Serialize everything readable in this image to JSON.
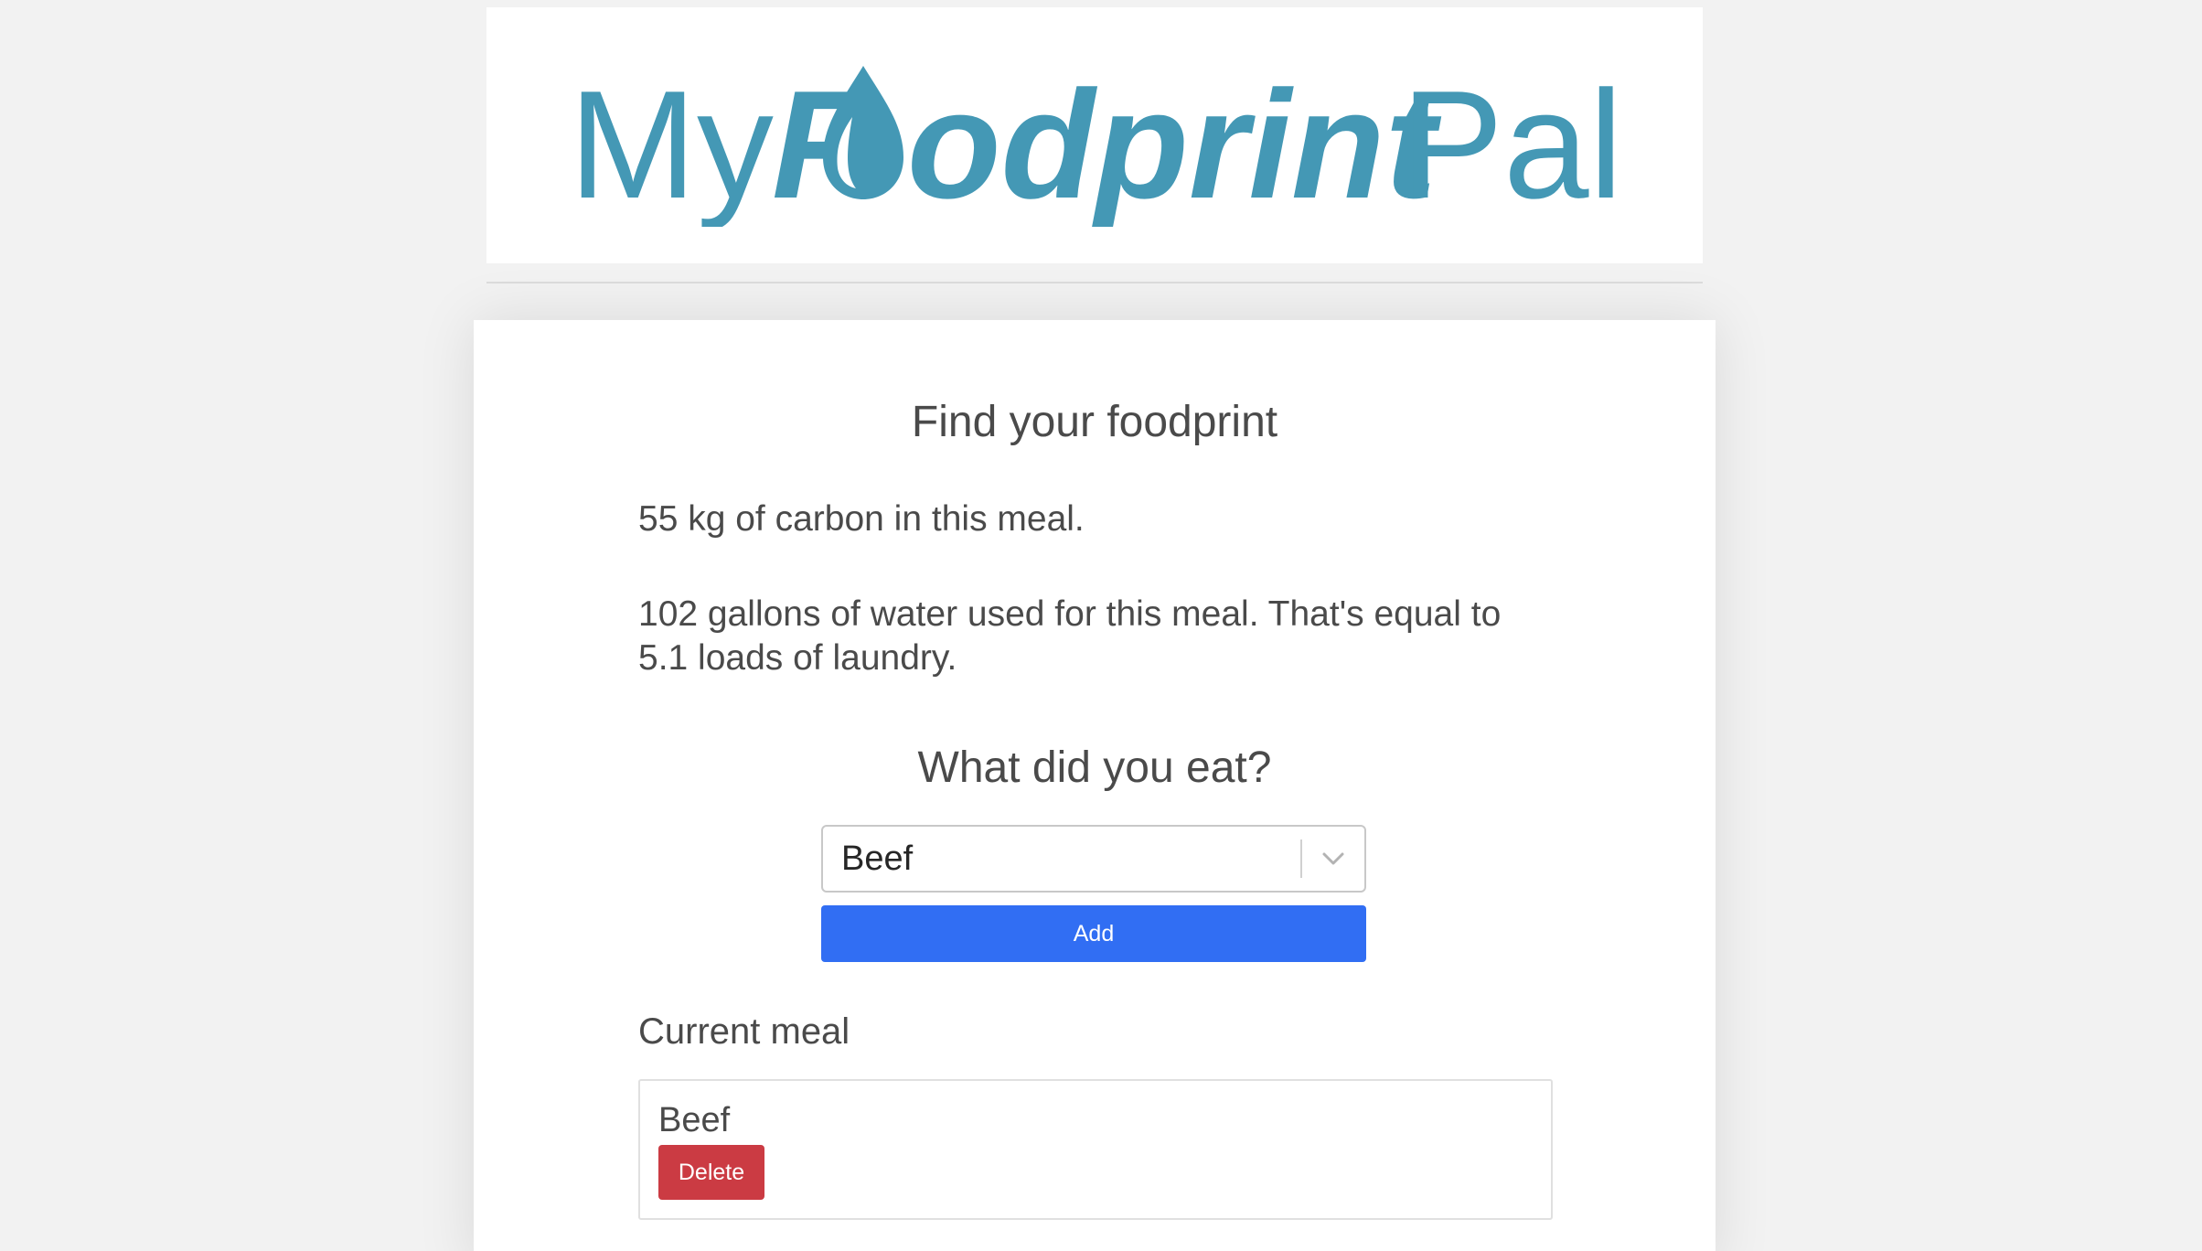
{
  "header": {
    "logo": {
      "part1": "My",
      "part2_f": "F",
      "part2_rest": "odprint",
      "part3": "Pal",
      "color": "#4498b5"
    }
  },
  "card": {
    "title": "Find your foodprint",
    "carbon_text": "55 kg of carbon in this meal.",
    "water_line1": "102 gallons of water used for this meal. That's equal to",
    "water_line2": "5.1 loads of laundry.",
    "eat_title": "What did you eat?",
    "food_select": {
      "value": "Beef",
      "icon": "chevron-down-icon"
    },
    "add_label": "Add",
    "current_meal_title": "Current meal",
    "meal_items": [
      {
        "name": "Beef",
        "delete_label": "Delete"
      }
    ]
  },
  "colors": {
    "primary_button": "#316ef3",
    "danger_button": "#cb3b43",
    "background": "#f2f2f2"
  }
}
